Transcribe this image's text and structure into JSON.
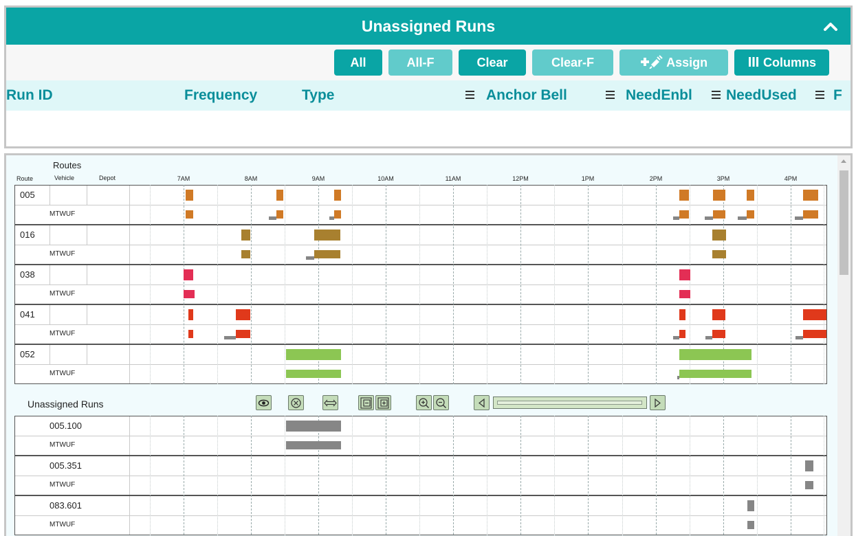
{
  "unassigned_panel": {
    "title": "Unassigned Runs",
    "toolbar": {
      "all": "All",
      "all_f": "All-F",
      "clear": "Clear",
      "clear_f": "Clear-F",
      "assign": "Assign",
      "columns": "Columns"
    },
    "columns": {
      "run_id": "Run ID",
      "frequency": "Frequency",
      "type": "Type",
      "anchor_bell": "Anchor Bell",
      "need_enbl": "NeedEnbl",
      "need_used": "NeedUsed",
      "more": "F"
    }
  },
  "gantt": {
    "header": {
      "routes": "Routes",
      "route": "Route",
      "vehicle": "Vehicle",
      "depot": "Depot"
    },
    "time_labels": [
      "7AM",
      "8AM",
      "9AM",
      "10AM",
      "11AM",
      "12PM",
      "1PM",
      "2PM",
      "3PM",
      "4PM"
    ],
    "routes": [
      {
        "route": "005",
        "frequency": "MTWUF"
      },
      {
        "route": "016",
        "frequency": "MTWUF"
      },
      {
        "route": "038",
        "frequency": "MTWUF"
      },
      {
        "route": "041",
        "frequency": "MTWUF"
      },
      {
        "route": "052",
        "frequency": "MTWUF"
      }
    ],
    "unassigned_title": "Unassigned Runs",
    "unassigned_runs": [
      {
        "run": "005.100",
        "frequency": "MTWUF"
      },
      {
        "run": "005.351",
        "frequency": "MTWUF"
      },
      {
        "run": "083.601",
        "frequency": "MTWUF"
      }
    ],
    "controls": [
      "eye-icon",
      "cancel-circle-icon",
      "fit-width-icon",
      "row-collapse-icon",
      "row-expand-icon",
      "zoom-in-icon",
      "zoom-out-icon",
      "scroll-left-icon",
      "scroll-right-icon"
    ],
    "colors": {
      "route_005": "#d07a26",
      "route_016": "#a8802f",
      "route_038": "#e32e55",
      "route_041": "#e0391b",
      "route_052": "#8cc653",
      "deadhead": "#868686",
      "unassigned": "#868686",
      "header_teal": "#0aa5a5"
    }
  }
}
